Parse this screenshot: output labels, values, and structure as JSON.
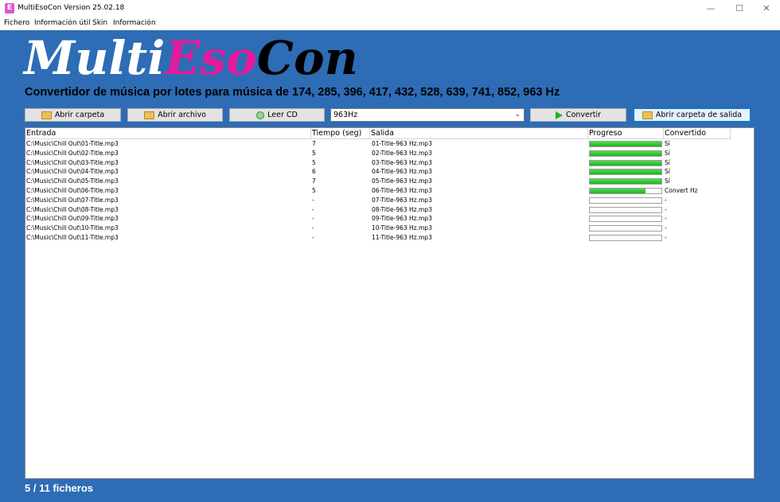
{
  "window": {
    "title": "MultiEsoCon Version 25.02.18",
    "icon_letter": "E",
    "icon_color": "#d85ad0",
    "minimize_glyph": "—",
    "maximize_glyph": "☐",
    "close_glyph": "✕"
  },
  "menu": {
    "items": [
      "Fichero",
      "Información útil",
      "Skin",
      "Información"
    ]
  },
  "header": {
    "logo_parts": [
      "Multi",
      "Eso",
      "Con"
    ],
    "logo_colors": [
      "#ffffff",
      "#e21c9c",
      "#000000"
    ],
    "subtitle": "Convertidor de música por lotes para música de 174, 285, 396, 417, 432, 528, 639, 741, 852, 963 Hz"
  },
  "toolbar": {
    "open_folder": "Abrir carpeta",
    "open_file": "Abrir archivo",
    "read_cd": "Leer CD",
    "frequency": "963Hz",
    "convert": "Convertir",
    "open_output": "Abrir carpeta de salida"
  },
  "table": {
    "columns": [
      "Entrada",
      "Tiempo (seg)",
      "Salida",
      "Progreso",
      "Convertido"
    ],
    "rows": [
      {
        "entrada": "C:\\Music\\Chill Out\\01-Title.mp3",
        "tiempo": "7",
        "salida": "01-Title-963 Hz.mp3",
        "progreso": 1.0,
        "convertido": "Sí"
      },
      {
        "entrada": "C:\\Music\\Chill Out\\02-Title.mp3",
        "tiempo": "5",
        "salida": "02-Title-963 Hz.mp3",
        "progreso": 1.0,
        "convertido": "Sí"
      },
      {
        "entrada": "C:\\Music\\Chill Out\\03-Title.mp3",
        "tiempo": "5",
        "salida": "03-Title-963 Hz.mp3",
        "progreso": 1.0,
        "convertido": "Sí"
      },
      {
        "entrada": "C:\\Music\\Chill Out\\04-Title.mp3",
        "tiempo": "6",
        "salida": "04-Title-963 Hz.mp3",
        "progreso": 1.0,
        "convertido": "Sí"
      },
      {
        "entrada": "C:\\Music\\Chill Out\\05-Title.mp3",
        "tiempo": "7",
        "salida": "05-Title-963 Hz.mp3",
        "progreso": 1.0,
        "convertido": "Sí"
      },
      {
        "entrada": "C:\\Music\\Chill Out\\06-Title.mp3",
        "tiempo": "5",
        "salida": "06-Title-963 Hz.mp3",
        "progreso": 0.78,
        "convertido": "Convert Hz"
      },
      {
        "entrada": "C:\\Music\\Chill Out\\07-Title.mp3",
        "tiempo": "-",
        "salida": "07-Title-963 Hz.mp3",
        "progreso": 0,
        "convertido": "-"
      },
      {
        "entrada": "C:\\Music\\Chill Out\\08-Title.mp3",
        "tiempo": "-",
        "salida": "08-Title-963 Hz.mp3",
        "progreso": 0,
        "convertido": "-"
      },
      {
        "entrada": "C:\\Music\\Chill Out\\09-Title.mp3",
        "tiempo": "-",
        "salida": "09-Title-963 Hz.mp3",
        "progreso": 0,
        "convertido": "-"
      },
      {
        "entrada": "C:\\Music\\Chill Out\\10-Title.mp3",
        "tiempo": "-",
        "salida": "10-Title-963 Hz.mp3",
        "progreso": 0,
        "convertido": "-"
      },
      {
        "entrada": "C:\\Music\\Chill Out\\11-Title.mp3",
        "tiempo": "-",
        "salida": "11-Title-963 Hz.mp3",
        "progreso": 0,
        "convertido": "-"
      }
    ]
  },
  "status": {
    "text": "5 / 11 ficheros"
  },
  "colors": {
    "client_bg": "#2e6cb5",
    "progress_fill": "#2fc42f"
  }
}
